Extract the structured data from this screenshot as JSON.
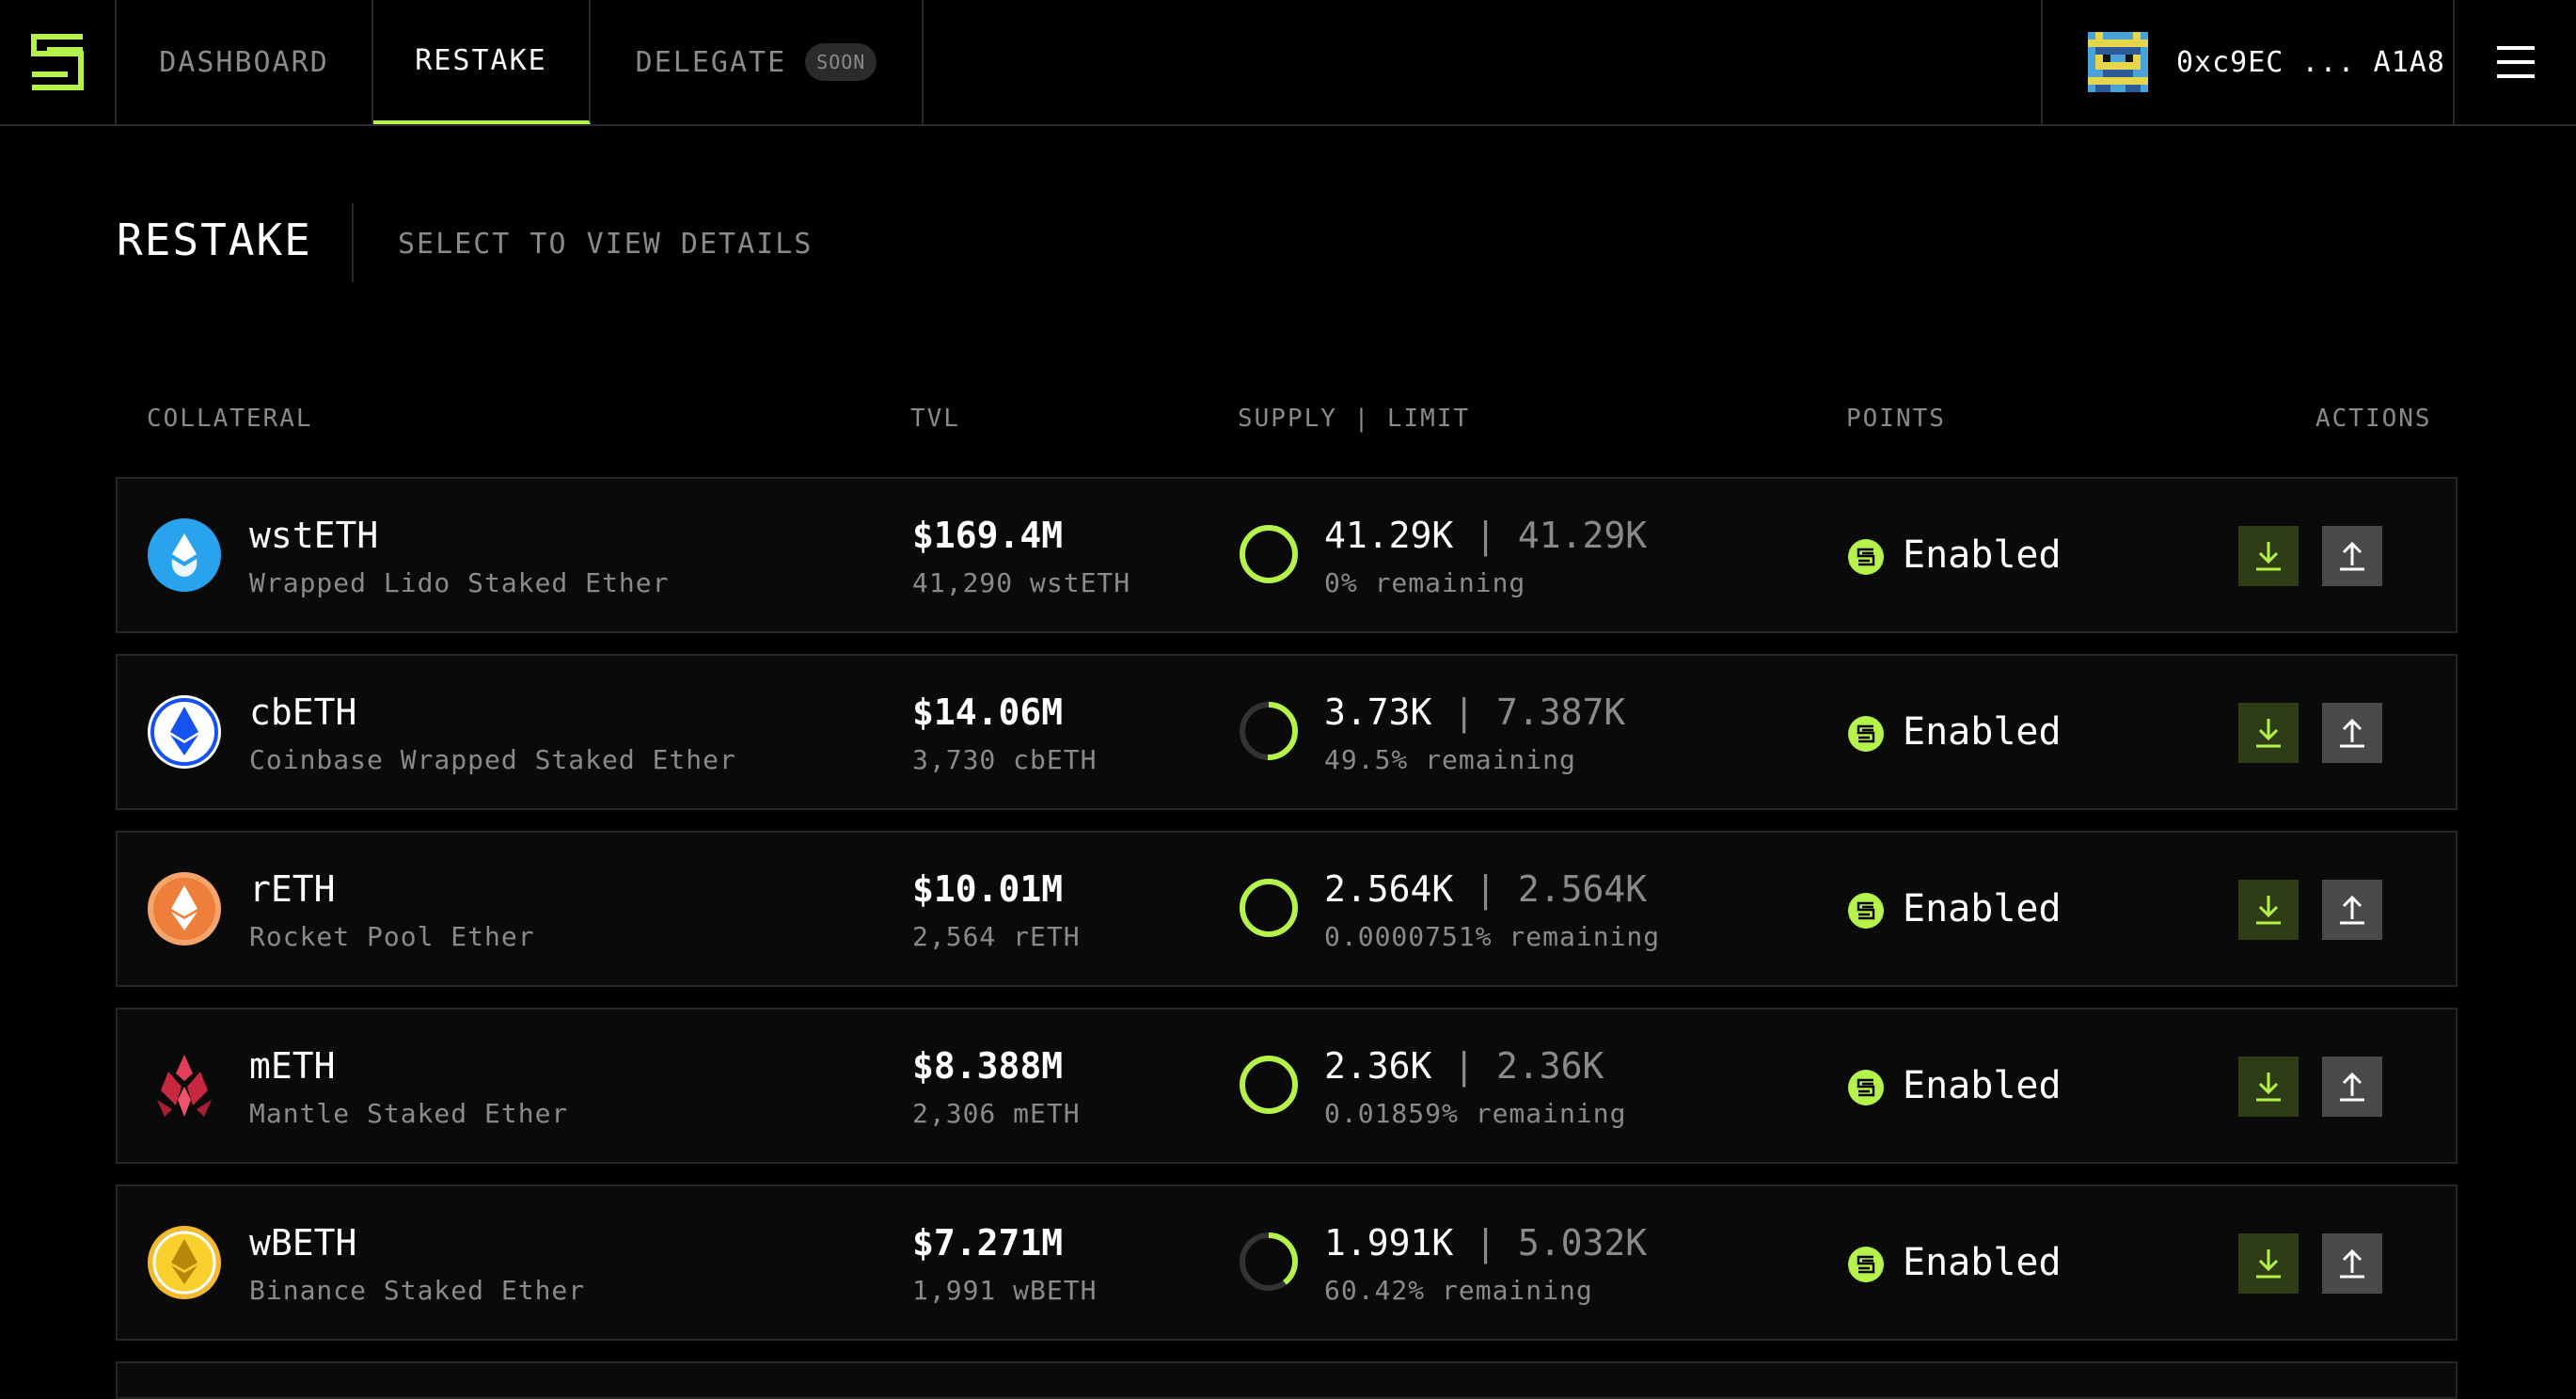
{
  "nav": {
    "tabs": [
      {
        "label": "DASHBOARD"
      },
      {
        "label": "RESTAKE"
      },
      {
        "label": "DELEGATE",
        "badge": "SOON"
      }
    ],
    "wallet_address": "0xc9EC ... A1A8"
  },
  "page": {
    "title": "RESTAKE",
    "subtitle": "SELECT TO VIEW DETAILS"
  },
  "table": {
    "headers": {
      "collateral": "COLLATERAL",
      "tvl": "TVL",
      "supply_limit": "SUPPLY | LIMIT",
      "points": "POINTS",
      "actions": "ACTIONS"
    },
    "rows": [
      {
        "symbol": "wstETH",
        "name": "Wrapped Lido Staked Ether",
        "tvl_usd": "$169.4M",
        "tvl_amount": "41,290 wstETH",
        "supply": "41.29K",
        "limit": "41.29K",
        "remaining": "0% remaining",
        "fill": 1.0,
        "points": "Enabled",
        "icon": "lido-wsteth-icon"
      },
      {
        "symbol": "cbETH",
        "name": "Coinbase Wrapped Staked Ether",
        "tvl_usd": "$14.06M",
        "tvl_amount": "3,730 cbETH",
        "supply": "3.73K",
        "limit": "7.387K",
        "remaining": "49.5% remaining",
        "fill": 0.505,
        "points": "Enabled",
        "icon": "coinbase-cbeth-icon"
      },
      {
        "symbol": "rETH",
        "name": "Rocket Pool Ether",
        "tvl_usd": "$10.01M",
        "tvl_amount": "2,564 rETH",
        "supply": "2.564K",
        "limit": "2.564K",
        "remaining": "0.0000751% remaining",
        "fill": 1.0,
        "points": "Enabled",
        "icon": "rocketpool-reth-icon"
      },
      {
        "symbol": "mETH",
        "name": "Mantle Staked Ether",
        "tvl_usd": "$8.388M",
        "tvl_amount": "2,306 mETH",
        "supply": "2.36K",
        "limit": "2.36K",
        "remaining": "0.01859% remaining",
        "fill": 1.0,
        "points": "Enabled",
        "icon": "mantle-meth-icon"
      },
      {
        "symbol": "wBETH",
        "name": "Binance Staked Ether",
        "tvl_usd": "$7.271M",
        "tvl_amount": "1,991 wBETH",
        "supply": "1.991K",
        "limit": "5.032K",
        "remaining": "60.42% remaining",
        "fill": 0.3958,
        "points": "Enabled",
        "icon": "binance-wbeth-icon"
      }
    ]
  },
  "colors": {
    "accent": "#b5f24a",
    "background": "#000000",
    "row_bg": "#0a0a0a",
    "muted_text": "#8a8a8a"
  }
}
